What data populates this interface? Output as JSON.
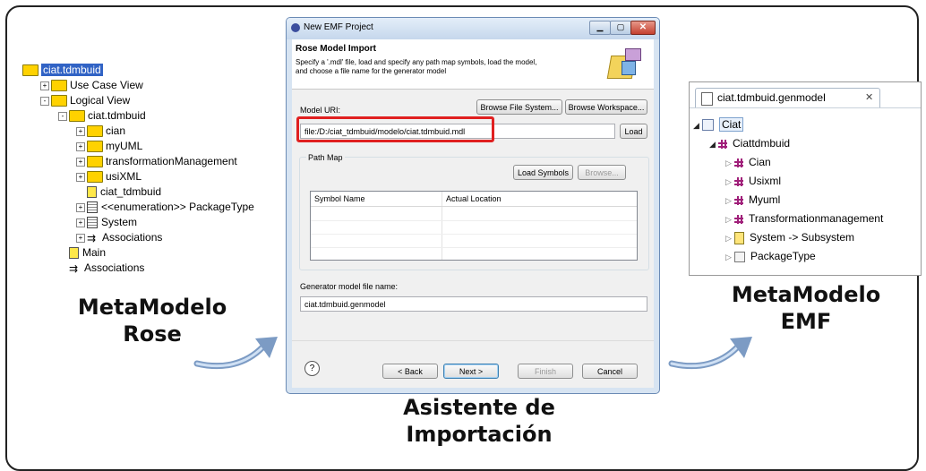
{
  "rose": {
    "label_line1": "MetaModelo",
    "label_line2": "Rose",
    "tree": [
      {
        "text": "ciat.tdmbuid",
        "indent": 0,
        "icon": "folder-icon",
        "expander": "",
        "selected": true
      },
      {
        "text": "Use Case View",
        "indent": 1,
        "icon": "folder-icon",
        "expander": "+"
      },
      {
        "text": "Logical View",
        "indent": 1,
        "icon": "folder-icon",
        "expander": "-"
      },
      {
        "text": "ciat.tdmbuid",
        "indent": 2,
        "icon": "folder-icon",
        "expander": "-"
      },
      {
        "text": "cian",
        "indent": 3,
        "icon": "folder-icon",
        "expander": "+"
      },
      {
        "text": "myUML",
        "indent": 3,
        "icon": "folder-icon",
        "expander": "+"
      },
      {
        "text": "transformationManagement",
        "indent": 3,
        "icon": "folder-icon",
        "expander": "+"
      },
      {
        "text": "usiXML",
        "indent": 3,
        "icon": "folder-icon",
        "expander": "+"
      },
      {
        "text": "ciat_tdmbuid",
        "indent": 3,
        "icon": "diagram-icon",
        "expander": ""
      },
      {
        "text": "<<enumeration>> PackageType",
        "indent": 3,
        "icon": "class-icon",
        "expander": "+"
      },
      {
        "text": "System",
        "indent": 3,
        "icon": "class-icon",
        "expander": "+"
      },
      {
        "text": "Associations",
        "indent": 3,
        "icon": "association-icon",
        "expander": "+"
      },
      {
        "text": "Main",
        "indent": 2,
        "icon": "diagram-icon",
        "expander": ""
      },
      {
        "text": "Associations",
        "indent": 2,
        "icon": "association-icon",
        "expander": ""
      }
    ]
  },
  "dialog": {
    "title": "New EMF Project",
    "header_title": "Rose Model Import",
    "header_desc_line1": "Specify a '.mdl' file, load and specify any path map symbols, load the model,",
    "header_desc_line2": "and choose a file name for the generator model",
    "model_uri_label": "Model URI:",
    "browse_fs": "Browse File System...",
    "browse_ws": "Browse Workspace...",
    "model_uri_value": "file:/D:/ciat_tdmbuid/modelo/ciat.tdmbuid.mdl",
    "load": "Load",
    "path_map_label": "Path Map",
    "load_symbols": "Load Symbols",
    "browse": "Browse...",
    "col_symbol": "Symbol Name",
    "col_location": "Actual Location",
    "gen_label": "Generator model file name:",
    "gen_value": "ciat.tdmbuid.genmodel",
    "help": "?",
    "back": "< Back",
    "next": "Next >",
    "finish": "Finish",
    "cancel": "Cancel",
    "highlight_color": "#e02020"
  },
  "wizard_label_line1": "Asistente de",
  "wizard_label_line2": "Importación",
  "emf": {
    "tab": "ciat.tdmbuid.genmodel",
    "tab_close": "✕",
    "label_line1": "MetaModelo",
    "label_line2": "EMF",
    "tree": [
      {
        "text": "Ciat",
        "indent": 0,
        "icon": "genmodel-icon",
        "expander": "◢"
      },
      {
        "text": "Ciattdmbuid",
        "indent": 1,
        "icon": "package-icon",
        "expander": "◢"
      },
      {
        "text": "Cian",
        "indent": 2,
        "icon": "package-icon",
        "expander": "▷"
      },
      {
        "text": "Usixml",
        "indent": 2,
        "icon": "package-icon",
        "expander": "▷"
      },
      {
        "text": "Myuml",
        "indent": 2,
        "icon": "package-icon",
        "expander": "▷"
      },
      {
        "text": "Transformationmanagement",
        "indent": 2,
        "icon": "package-icon",
        "expander": "▷"
      },
      {
        "text": "System -> Subsystem",
        "indent": 2,
        "icon": "class-icon",
        "expander": "▷"
      },
      {
        "text": "PackageType",
        "indent": 2,
        "icon": "enum-icon",
        "expander": "▷"
      }
    ]
  }
}
